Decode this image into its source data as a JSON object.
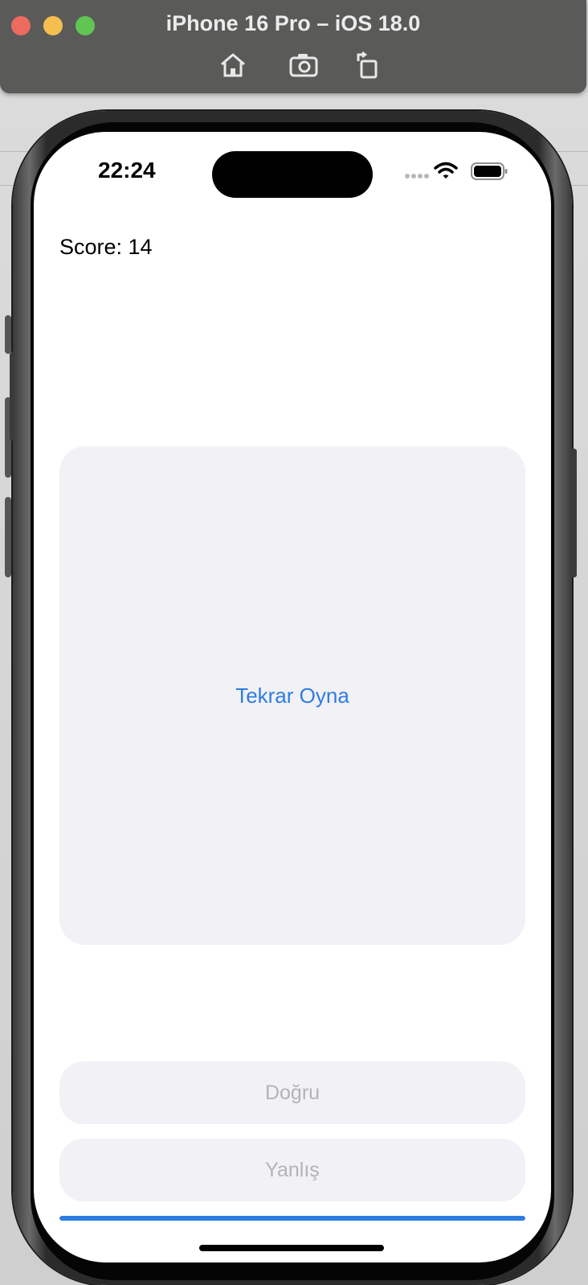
{
  "window": {
    "title": "iPhone 16 Pro – iOS 18.0",
    "toolbar": [
      "home-icon",
      "screenshot-icon",
      "rotate-icon"
    ]
  },
  "status_bar": {
    "time": "22:24",
    "icons": [
      "cellular-dots-icon",
      "wifi-icon",
      "battery-icon"
    ]
  },
  "game": {
    "score_label": "Score: 14",
    "card_button_label": "Tekrar Oyna",
    "true_button_label": "Doğru",
    "false_button_label": "Yanlış",
    "progress": 1.0
  },
  "colors": {
    "accent": "#2f7de0",
    "card_bg": "#f1f1f6",
    "disabled_text": "#b3b3b8",
    "titlebar": "#5a5a58"
  }
}
